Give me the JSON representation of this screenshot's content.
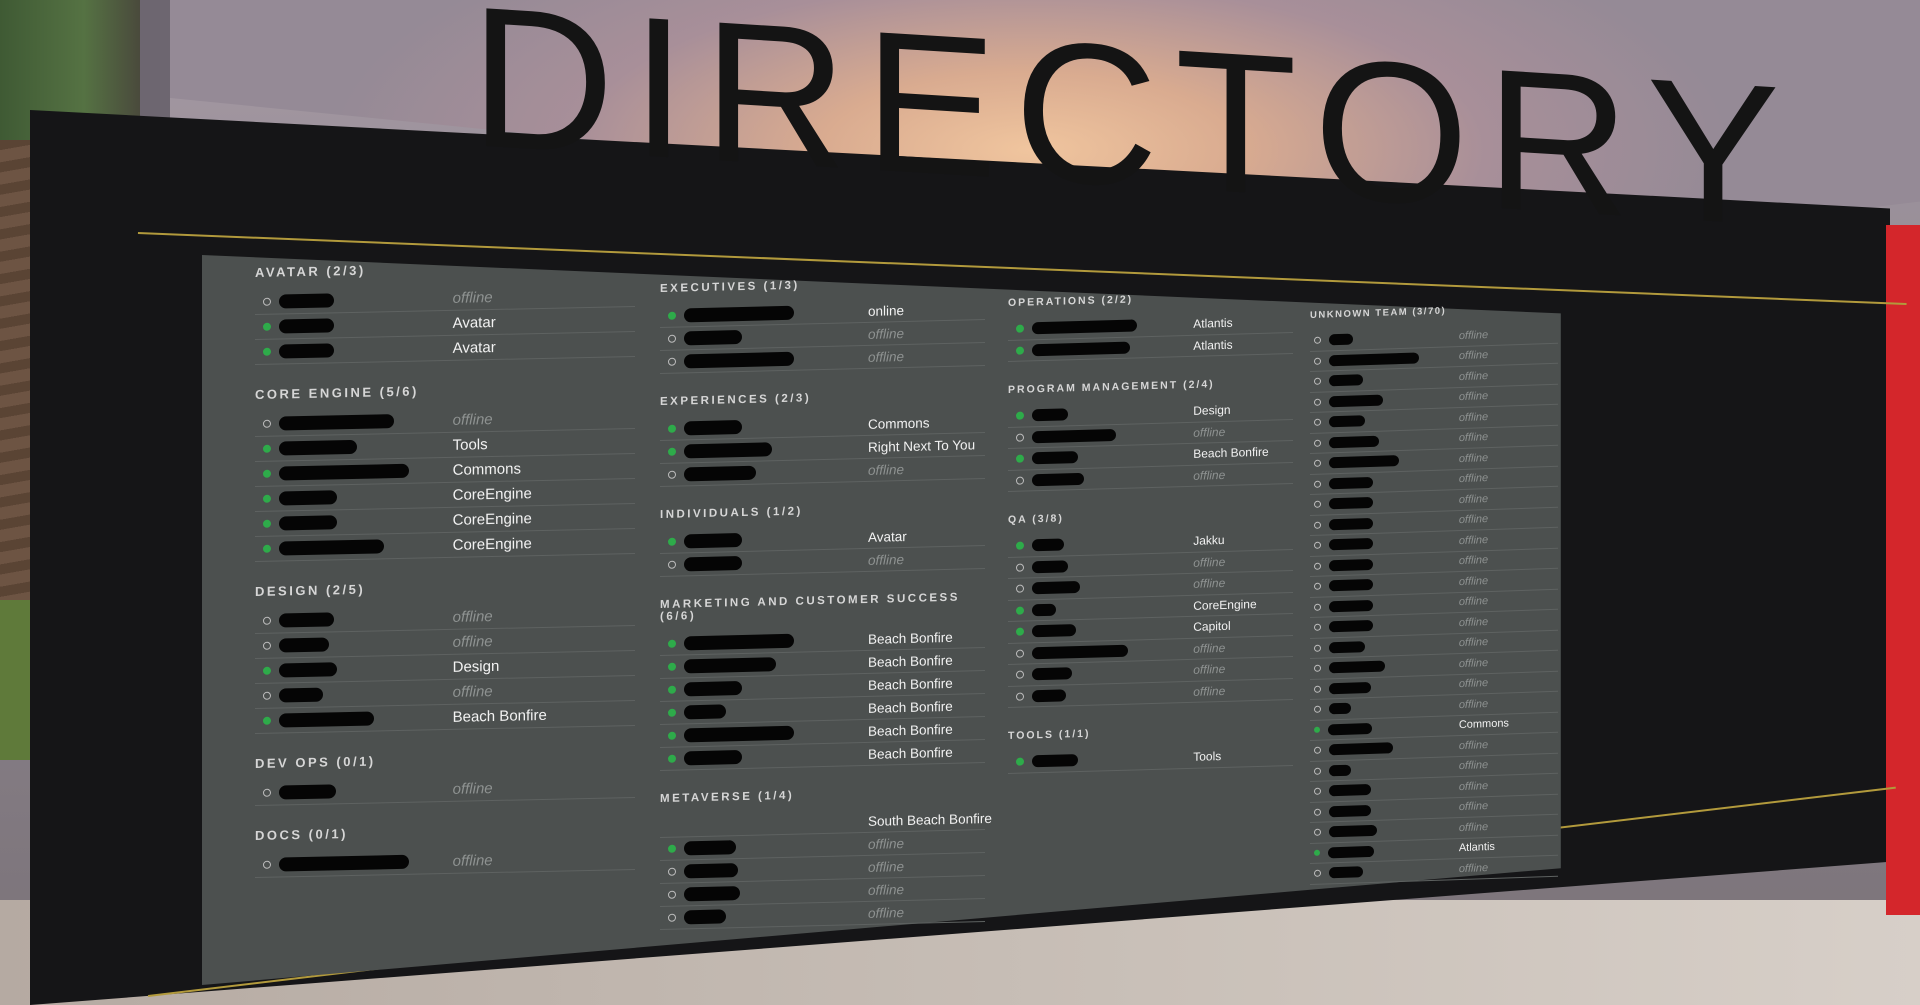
{
  "sign": {
    "title": "DIRECTORY",
    "letters": [
      "D",
      "I",
      "R",
      "E",
      "C",
      "T",
      "O",
      "R",
      "Y"
    ]
  },
  "colors": {
    "online": "#2eab4a",
    "board": "#151517",
    "panel": "#4c504f",
    "accent_line": "#b29a3c",
    "wall": "#d4262b"
  },
  "columns": [
    {
      "groups": [
        {
          "title": "AVATAR (2/3)",
          "rows": [
            {
              "online": false,
              "status": "offline",
              "w": 55
            },
            {
              "online": true,
              "status": "Avatar",
              "w": 55
            },
            {
              "online": true,
              "status": "Avatar",
              "w": 55
            }
          ]
        },
        {
          "title": "CORE ENGINE (5/6)",
          "rows": [
            {
              "online": false,
              "status": "offline",
              "w": 115
            },
            {
              "online": true,
              "status": "Tools",
              "w": 78
            },
            {
              "online": true,
              "status": "Commons",
              "w": 130
            },
            {
              "online": true,
              "status": "CoreEngine",
              "w": 58
            },
            {
              "online": true,
              "status": "CoreEngine",
              "w": 58
            },
            {
              "online": true,
              "status": "CoreEngine",
              "w": 105
            }
          ]
        },
        {
          "title": "DESIGN (2/5)",
          "rows": [
            {
              "online": false,
              "status": "offline",
              "w": 55
            },
            {
              "online": false,
              "status": "offline",
              "w": 50
            },
            {
              "online": true,
              "status": "Design",
              "w": 58
            },
            {
              "online": false,
              "status": "offline",
              "w": 44
            },
            {
              "online": true,
              "status": "Beach Bonfire",
              "w": 95
            }
          ]
        },
        {
          "title": "DEV OPS (0/1)",
          "rows": [
            {
              "online": false,
              "status": "offline",
              "w": 57
            }
          ]
        },
        {
          "title": "DOCS (0/1)",
          "rows": [
            {
              "online": false,
              "status": "offline",
              "w": 130
            }
          ]
        }
      ]
    },
    {
      "groups": [
        {
          "title": "EXECUTIVES (1/3)",
          "rows": [
            {
              "online": true,
              "status": "online",
              "w": 110
            },
            {
              "online": false,
              "status": "offline",
              "w": 58
            },
            {
              "online": false,
              "status": "offline",
              "w": 110
            }
          ]
        },
        {
          "title": "EXPERIENCES (2/3)",
          "rows": [
            {
              "online": true,
              "status": "Commons",
              "w": 58
            },
            {
              "online": true,
              "status": "Right Next To You",
              "w": 88
            },
            {
              "online": false,
              "status": "offline",
              "w": 72
            }
          ]
        },
        {
          "title": "INDIVIDUALS (1/2)",
          "rows": [
            {
              "online": true,
              "status": "Avatar",
              "w": 58
            },
            {
              "online": false,
              "status": "offline",
              "w": 58
            }
          ]
        },
        {
          "title": "MARKETING AND CUSTOMER SUCCESS (6/6)",
          "rows": [
            {
              "online": true,
              "status": "Beach Bonfire",
              "w": 110
            },
            {
              "online": true,
              "status": "Beach Bonfire",
              "w": 92
            },
            {
              "online": true,
              "status": "Beach Bonfire",
              "w": 58
            },
            {
              "online": true,
              "status": "Beach Bonfire",
              "w": 42
            },
            {
              "online": true,
              "status": "Beach Bonfire",
              "w": 110
            },
            {
              "online": true,
              "status": "Beach Bonfire",
              "w": 58
            }
          ]
        },
        {
          "title": "METAVERSE (1/4)",
          "rows": [
            {
              "online": false,
              "status": "South Beach Bonfire",
              "w": 0
            },
            {
              "online": true,
              "status": "offline",
              "w": 52
            },
            {
              "online": false,
              "status": "offline",
              "w": 54
            },
            {
              "online": false,
              "status": "offline",
              "w": 56
            },
            {
              "online": false,
              "status": "offline",
              "w": 42
            }
          ]
        }
      ]
    },
    {
      "groups": [
        {
          "title": "OPERATIONS (2/2)",
          "rows": [
            {
              "online": true,
              "status": "Atlantis",
              "w": 105
            },
            {
              "online": true,
              "status": "Atlantis",
              "w": 98
            }
          ]
        },
        {
          "title": "PROGRAM MANAGEMENT (2/4)",
          "rows": [
            {
              "online": true,
              "status": "Design",
              "w": 36
            },
            {
              "online": false,
              "status": "offline",
              "w": 84
            },
            {
              "online": true,
              "status": "Beach Bonfire",
              "w": 46
            },
            {
              "online": false,
              "status": "offline",
              "w": 52
            }
          ]
        },
        {
          "title": "QA (3/8)",
          "rows": [
            {
              "online": true,
              "status": "Jakku",
              "w": 32
            },
            {
              "online": false,
              "status": "offline",
              "w": 36
            },
            {
              "online": false,
              "status": "offline",
              "w": 48
            },
            {
              "online": true,
              "status": "CoreEngine",
              "w": 24
            },
            {
              "online": true,
              "status": "Capitol",
              "w": 44
            },
            {
              "online": false,
              "status": "offline",
              "w": 96
            },
            {
              "online": false,
              "status": "offline",
              "w": 40
            },
            {
              "online": false,
              "status": "offline",
              "w": 34
            }
          ]
        },
        {
          "title": "TOOLS (1/1)",
          "rows": [
            {
              "online": true,
              "status": "Tools",
              "w": 46
            }
          ]
        }
      ]
    },
    {
      "groups": [
        {
          "title": "UNKNOWN TEAM (3/70)",
          "rows": [
            {
              "online": false,
              "status": "offline",
              "w": 24
            },
            {
              "online": false,
              "status": "offline",
              "w": 90
            },
            {
              "online": false,
              "status": "offline",
              "w": 34
            },
            {
              "online": false,
              "status": "offline",
              "w": 54
            },
            {
              "online": false,
              "status": "offline",
              "w": 36
            },
            {
              "online": false,
              "status": "offline",
              "w": 50
            },
            {
              "online": false,
              "status": "offline",
              "w": 70
            },
            {
              "online": false,
              "status": "offline",
              "w": 44
            },
            {
              "online": false,
              "status": "offline",
              "w": 44
            },
            {
              "online": false,
              "status": "offline",
              "w": 44
            },
            {
              "online": false,
              "status": "offline",
              "w": 44
            },
            {
              "online": false,
              "status": "offline",
              "w": 44
            },
            {
              "online": false,
              "status": "offline",
              "w": 44
            },
            {
              "online": false,
              "status": "offline",
              "w": 44
            },
            {
              "online": false,
              "status": "offline",
              "w": 44
            },
            {
              "online": false,
              "status": "offline",
              "w": 36
            },
            {
              "online": false,
              "status": "offline",
              "w": 56
            },
            {
              "online": false,
              "status": "offline",
              "w": 42
            },
            {
              "online": false,
              "status": "offline",
              "w": 22
            },
            {
              "online": true,
              "status": "Commons",
              "w": 44
            },
            {
              "online": false,
              "status": "offline",
              "w": 64
            },
            {
              "online": false,
              "status": "offline",
              "w": 22
            },
            {
              "online": false,
              "status": "offline",
              "w": 42
            },
            {
              "online": false,
              "status": "offline",
              "w": 42
            },
            {
              "online": false,
              "status": "offline",
              "w": 48
            },
            {
              "online": true,
              "status": "Atlantis",
              "w": 46
            },
            {
              "online": false,
              "status": "offline",
              "w": 34
            }
          ]
        }
      ]
    }
  ]
}
